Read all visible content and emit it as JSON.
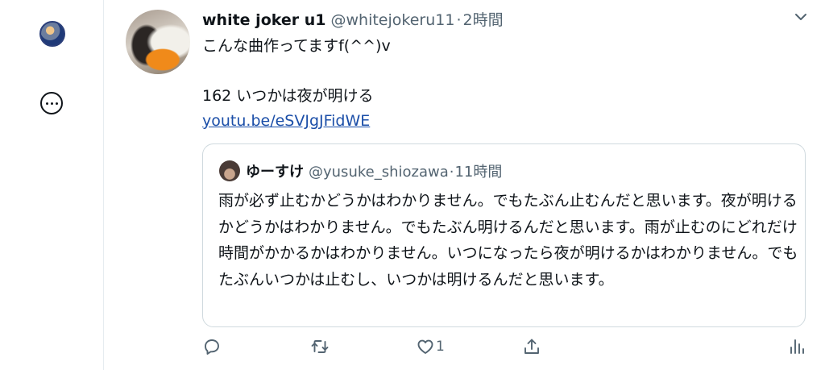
{
  "tweet": {
    "display_name": "white joker u1",
    "handle": "@whitejokeru11",
    "separator": "·",
    "time": "2時間",
    "text_line1": "こんな曲作ってますf(^^)v",
    "text_line2": "162 いつかは夜が明ける",
    "link": "youtu.be/eSVJgJFidWE"
  },
  "quote": {
    "display_name": "ゆーすけ",
    "handle": "@yusuke_shiozawa",
    "separator": "·",
    "time": "11時間",
    "text": "雨が必ず止むかどうかはわかりません。でもたぶん止むんだと思います。夜が明けるかどうかはわかりません。でもたぶん明けるんだと思います。雨が止むのにどれだけ時間がかかるかはわかりません。いつになったら夜が明けるかはわかりません。でもたぶんいつかは止むし、いつかは明けるんだと思います。"
  },
  "actions": {
    "reply_icon": "reply-icon",
    "retweet_icon": "retweet-icon",
    "like_icon": "heart-icon",
    "like_count": "1",
    "share_icon": "share-icon",
    "analytics_icon": "analytics-icon"
  }
}
